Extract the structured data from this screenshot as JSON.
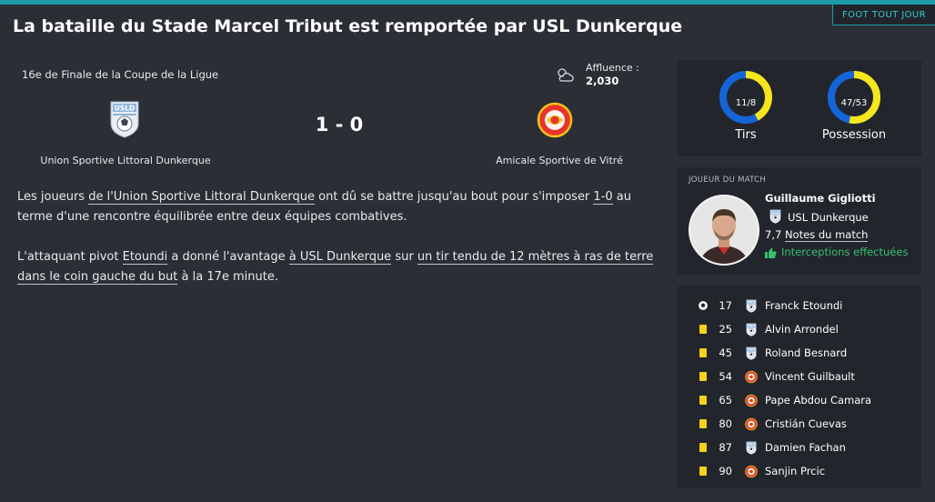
{
  "header": {
    "title": "La bataille du Stade Marcel Tribut est remportée par USL Dunkerque",
    "tag": "FOOT TOUT JOUR"
  },
  "match": {
    "competition": "16e de Finale de la Coupe de la Ligue",
    "attendance_label": "Affluence :",
    "attendance_value": "2,030",
    "score": "1 - 0",
    "home_team": "Union Sportive Littoral Dunkerque",
    "away_team": "Amicale Sportive de Vitré"
  },
  "article": {
    "p1": {
      "a": "Les joueurs ",
      "b": "de l'Union Sportive Littoral Dunkerque",
      "c": " ont dû se battre jusqu'au bout pour s'imposer ",
      "d": "1-0",
      "e": " au terme d'une rencontre équilibrée entre deux équipes combatives."
    },
    "p2": {
      "a": "L'attaquant pivot ",
      "b": "Etoundi",
      "c": " a donné l'avantage ",
      "d": "à USL Dunkerque",
      "e": " sur ",
      "f": "un tir tendu de 12 mètres à ras de terre dans le coin gauche du but",
      "g": " à la 17e minute."
    }
  },
  "stats": {
    "shots": {
      "label": "Tirs",
      "value": "11/8",
      "home": 11,
      "away": 8
    },
    "possession": {
      "label": "Possession",
      "value": "47/53",
      "home": 47,
      "away": 53
    },
    "colors": {
      "home": "#1565d8",
      "away": "#f5e61e"
    }
  },
  "motm": {
    "heading": "JOUEUR DU MATCH",
    "name": "Guillaume Gigliotti",
    "club": "USL Dunkerque",
    "rating_value": "7,7",
    "rating_label": "Notes du match",
    "feature": "Interceptions effectuées"
  },
  "events": [
    {
      "type": "goal",
      "minute": "17",
      "team": "home",
      "player": "Franck Etoundi"
    },
    {
      "type": "yellow-card",
      "minute": "25",
      "team": "home",
      "player": "Alvin Arrondel"
    },
    {
      "type": "yellow-card",
      "minute": "45",
      "team": "home",
      "player": "Roland Besnard"
    },
    {
      "type": "yellow-card",
      "minute": "54",
      "team": "away",
      "player": "Vincent Guilbault"
    },
    {
      "type": "yellow-card",
      "minute": "65",
      "team": "away",
      "player": "Pape Abdou Camara"
    },
    {
      "type": "yellow-card",
      "minute": "80",
      "team": "away",
      "player": "Cristián Cuevas"
    },
    {
      "type": "yellow-card",
      "minute": "87",
      "team": "home",
      "player": "Damien Fachan"
    },
    {
      "type": "yellow-card",
      "minute": "90",
      "team": "away",
      "player": "Sanjin Prcic"
    }
  ]
}
